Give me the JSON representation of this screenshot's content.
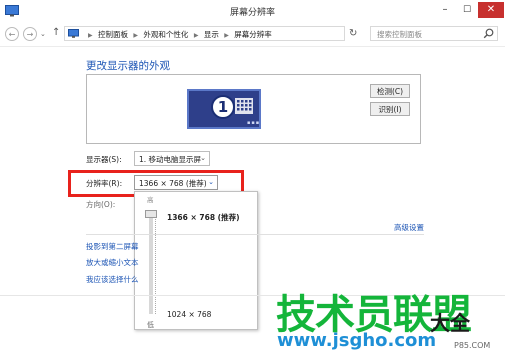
{
  "window": {
    "title": "屏幕分辨率",
    "minimize": "–",
    "maximize": "☐",
    "close": "✕"
  },
  "navigation": {
    "back": "←",
    "forward": "→",
    "recent": "⌄",
    "up": "↑",
    "breadcrumb": [
      "控制面板",
      "外观和个性化",
      "显示",
      "屏幕分辨率"
    ],
    "dropdown": "⌄",
    "refresh": "↻",
    "search_placeholder": "搜索控制面板"
  },
  "main": {
    "heading": "更改显示器的外观",
    "monitor_number": "1",
    "monitor_dots": "▪▪▪",
    "detect_label": "检测(C)",
    "identify_label": "识别(I)",
    "display_label": "显示器(S):",
    "display_value": "1. 移动电脑显示屏",
    "resolution_label": "分辨率(R):",
    "resolution_value": "1366 × 768 (推荐)",
    "orientation_label": "方向(O):",
    "advanced_link": "高级设置",
    "links": [
      "投影到第二屏幕",
      "放大或缩小文本",
      "我应该选择什么"
    ]
  },
  "slider_popup": {
    "top_label": "高",
    "current_option": "1366 × 768 (推荐)",
    "lower_option": "1024 × 768",
    "bottom_label": "低"
  },
  "chevron": "⌄",
  "watermark": {
    "text": "技术员联盟",
    "text2": "大全",
    "url": "www.jsgho.com",
    "footer": "P85.COM"
  },
  "colors": {
    "link_blue": "#1e56b5",
    "highlight_red": "#e8221c",
    "close_red": "#c7302e",
    "monitor_blue": "#2e3f8a",
    "watermark_green": "#14b53a"
  },
  "icons": [
    "control-panel-icon",
    "search-icon",
    "monitor-icon",
    "refresh-icon"
  ]
}
